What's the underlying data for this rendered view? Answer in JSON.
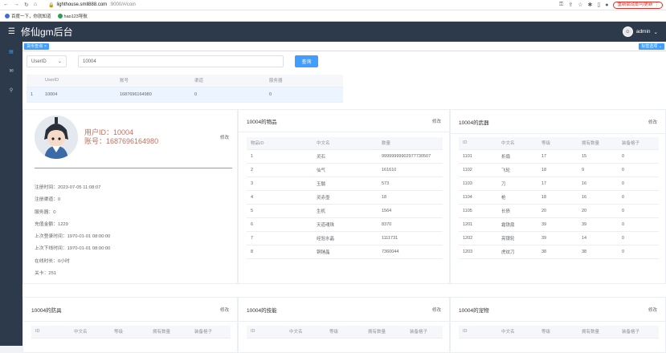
{
  "browser": {
    "url_host": "lighthouse.smll888.com",
    "url_path": ":9000/#/coin",
    "update_label": "重新启动即可更新"
  },
  "bookmarks": [
    {
      "label": "百度一下，你就知道"
    },
    {
      "label": "hao123导航"
    }
  ],
  "app": {
    "title": "修仙gm后台",
    "user": "admin"
  },
  "tags": {
    "active": "货币查询",
    "more": "标签选项"
  },
  "search": {
    "select_value": "UserID",
    "input_value": "10004",
    "button": "查询"
  },
  "result": {
    "headers": [
      "",
      "UserID",
      "账号",
      "渠道",
      "服务器"
    ],
    "rows": [
      [
        "1",
        "10004",
        "1687696164980",
        "0",
        "0"
      ]
    ]
  },
  "profile": {
    "userid_label": "用户ID：10004",
    "account_label": "账号：1687696164980",
    "edit": "修改",
    "fields": [
      "注册时间：2023-07-05 11:08:07",
      "注册渠道：0",
      "服务器：0",
      "充值金额：1229",
      "上次登录时间：1970-01-01 08:00:00",
      "上次下线时间：1970-01-01 08:00:00",
      "在线时长：0小时",
      "关卡：251"
    ]
  },
  "items": {
    "title": "10004的物品",
    "edit": "修改",
    "headers": [
      "物品ID",
      "中文名",
      "数量"
    ],
    "rows": [
      [
        "1",
        "灵石",
        "99999999902977730507"
      ],
      [
        "2",
        "仙气",
        "161610"
      ],
      [
        "3",
        "玉髓",
        "573"
      ],
      [
        "4",
        "灵赤壶",
        "18"
      ],
      [
        "5",
        "生机",
        "1564"
      ],
      [
        "6",
        "天道魂珠",
        "8370"
      ],
      [
        "7",
        "经验水晶",
        "1111731"
      ],
      [
        "8",
        "铜锤晶",
        "7360044"
      ]
    ]
  },
  "weapons": {
    "title": "10004的武器",
    "edit": "修改",
    "headers": [
      "ID",
      "中文名",
      "等级",
      "拥有数量",
      "装备格子"
    ],
    "rows": [
      [
        "1101",
        "折扇",
        "17",
        "15",
        "0"
      ],
      [
        "1102",
        "飞轮",
        "18",
        "9",
        "0"
      ],
      [
        "1103",
        "刀",
        "17",
        "16",
        "0"
      ],
      [
        "1104",
        "枪",
        "18",
        "16",
        "0"
      ],
      [
        "1105",
        "长债",
        "20",
        "20",
        "0"
      ],
      [
        "1201",
        "霜铁扇",
        "39",
        "39",
        "0"
      ],
      [
        "1202",
        "亮银轮",
        "39",
        "14",
        "0"
      ],
      [
        "1203",
        "虎纹刀",
        "38",
        "38",
        "0"
      ]
    ]
  },
  "armor": {
    "title": "10004的防具",
    "edit": "修改",
    "headers": [
      "ID",
      "中文名",
      "等级",
      "拥有数量",
      "装备格子"
    ]
  },
  "skills": {
    "title": "10004的技能",
    "edit": "修改",
    "headers": [
      "ID",
      "中文名",
      "等级",
      "拥有数量",
      "装备格子"
    ]
  },
  "pets": {
    "title": "10004的宠物",
    "edit": "修改",
    "headers": [
      "ID",
      "中文名",
      "等级",
      "拥有数量",
      "装备格子"
    ]
  }
}
